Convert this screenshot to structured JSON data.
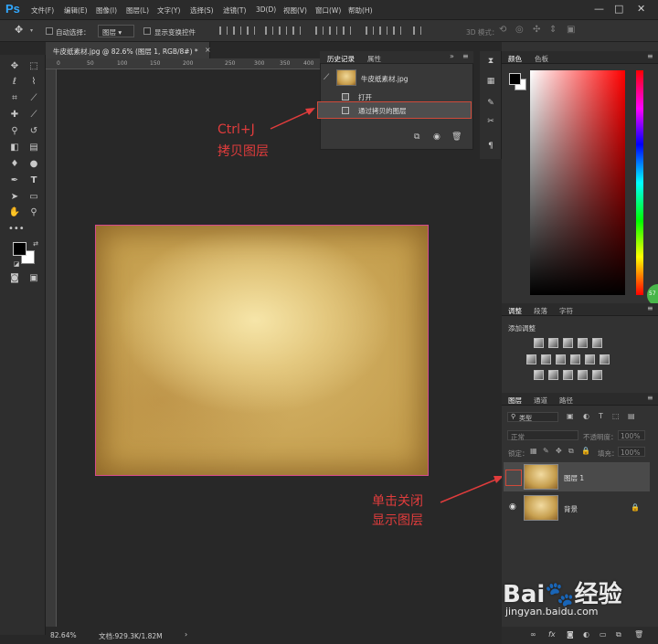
{
  "app": {
    "logo": "Ps",
    "menus": [
      "文件(F)",
      "编辑(E)",
      "图像(I)",
      "图层(L)",
      "文字(Y)",
      "选择(S)",
      "滤镜(T)",
      "3D(D)",
      "视图(V)",
      "窗口(W)",
      "帮助(H)"
    ],
    "window_controls": [
      "—",
      "□",
      "✕"
    ]
  },
  "options_bar": {
    "auto_select_label": "自动选择：",
    "auto_select_value": "图层",
    "show_transform_label": "显示变换控件",
    "mode_3d_label": "3D 模式："
  },
  "document": {
    "tab_title": "牛皮纸素材.jpg @ 82.6% (图层 1, RGB/8#) *",
    "ruler_ticks": [
      "0",
      "50",
      "100",
      "150",
      "200",
      "250",
      "300",
      "350",
      "400"
    ],
    "zoom": "82.64%",
    "doc_info": "文档:929.3K/1.82M"
  },
  "history_panel": {
    "tabs": [
      "历史记录",
      "属性"
    ],
    "snapshot_label": "牛皮纸素材.jpg",
    "items": [
      {
        "label": "打开"
      },
      {
        "label": "通过拷贝的图层"
      }
    ]
  },
  "annotations": {
    "ctrl_j_line1": "Ctrl+J",
    "ctrl_j_line2": "拷贝图层",
    "click_close_line1": "单击关闭",
    "click_close_line2": "显示图层"
  },
  "color_panel": {
    "tabs": [
      "颜色",
      "色板"
    ],
    "foreground": "#000000",
    "background": "#ffffff"
  },
  "adjustments_panel": {
    "tabs": [
      "调整",
      "段落",
      "字符"
    ],
    "title": "添加调整"
  },
  "layers_panel": {
    "tabs": [
      "图层",
      "通道",
      "路径"
    ],
    "filter_label": "类型",
    "blend_mode": "正常",
    "opacity_label": "不透明度：",
    "opacity_value": "100%",
    "lock_label": "锁定：",
    "fill_label": "填充：",
    "fill_value": "100%",
    "layers": [
      {
        "name": "图层 1",
        "visible": false,
        "selected": true
      },
      {
        "name": "背景",
        "visible": true,
        "selected": false,
        "locked": true
      }
    ]
  },
  "watermark": {
    "brand": "Bai🐾经验",
    "url": "jingyan.baidu.com"
  },
  "badge": "57"
}
